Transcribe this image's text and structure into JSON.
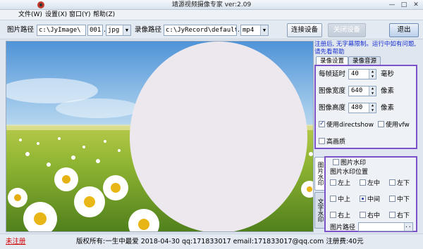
{
  "window": {
    "title": "靖源视频摄像专家 ver:2.09",
    "icon": "camera-app-icon",
    "controls": {
      "minimize": "—",
      "maximize": "□",
      "close": "✕"
    }
  },
  "menu": {
    "items": [
      "文件(W)",
      "设置(X)",
      "窗口(Y)",
      "帮助(Z)"
    ]
  },
  "toolbar": {
    "image_path_label": "图片路径",
    "image_path_value": "c:\\JyImage\\",
    "image_index_value": "001",
    "image_ext_dot": ".",
    "image_ext_value": "jpg",
    "record_path_label": "录像路径",
    "record_path_value": "c:\\JyRecord\\default",
    "record_ext_dot": ".",
    "record_ext_value": "mp4",
    "connect_button": "连接设备",
    "disconnect_button": "关闭设备",
    "exit_button": "退出"
  },
  "side": {
    "notice": "注册后, 无字幕限制。运行中如有问题, 请先看帮助",
    "tabs": [
      "录像设置",
      "录像音源"
    ],
    "record_settings": {
      "frame_delay_label": "每帧延时",
      "frame_delay_value": "40",
      "frame_delay_unit": "毫秒",
      "width_label": "图像宽度",
      "width_value": "640",
      "width_unit": "像素",
      "height_label": "图像高度",
      "height_value": "480",
      "height_unit": "像素",
      "use_directshow_label": "使用directshow",
      "use_directshow_checked": true,
      "use_vfw_label": "使用vfw",
      "use_vfw_checked": false,
      "high_quality_label": "高画质",
      "high_quality_checked": false
    },
    "vertical_tabs": [
      "图片水印",
      "文字水印"
    ],
    "watermark": {
      "enable_label": "图片水印",
      "enable_checked": false,
      "position_label": "图片水印位置",
      "positions": [
        "左上",
        "左中",
        "左下",
        "中上",
        "中间",
        "中下",
        "右上",
        "右中",
        "右下"
      ],
      "selected": "中间",
      "image_path_label": "图片路径",
      "browse_button": "..."
    }
  },
  "status": {
    "register_link": "未注册",
    "copyright": "版权所有:一生中最爱 2018-04-30 qq:171833017 email:171833017@qq.com 注册费:40元"
  },
  "colors": {
    "accent": "#7b52c7",
    "notice": "#1a2fd0",
    "unregistered": "#d10000"
  }
}
